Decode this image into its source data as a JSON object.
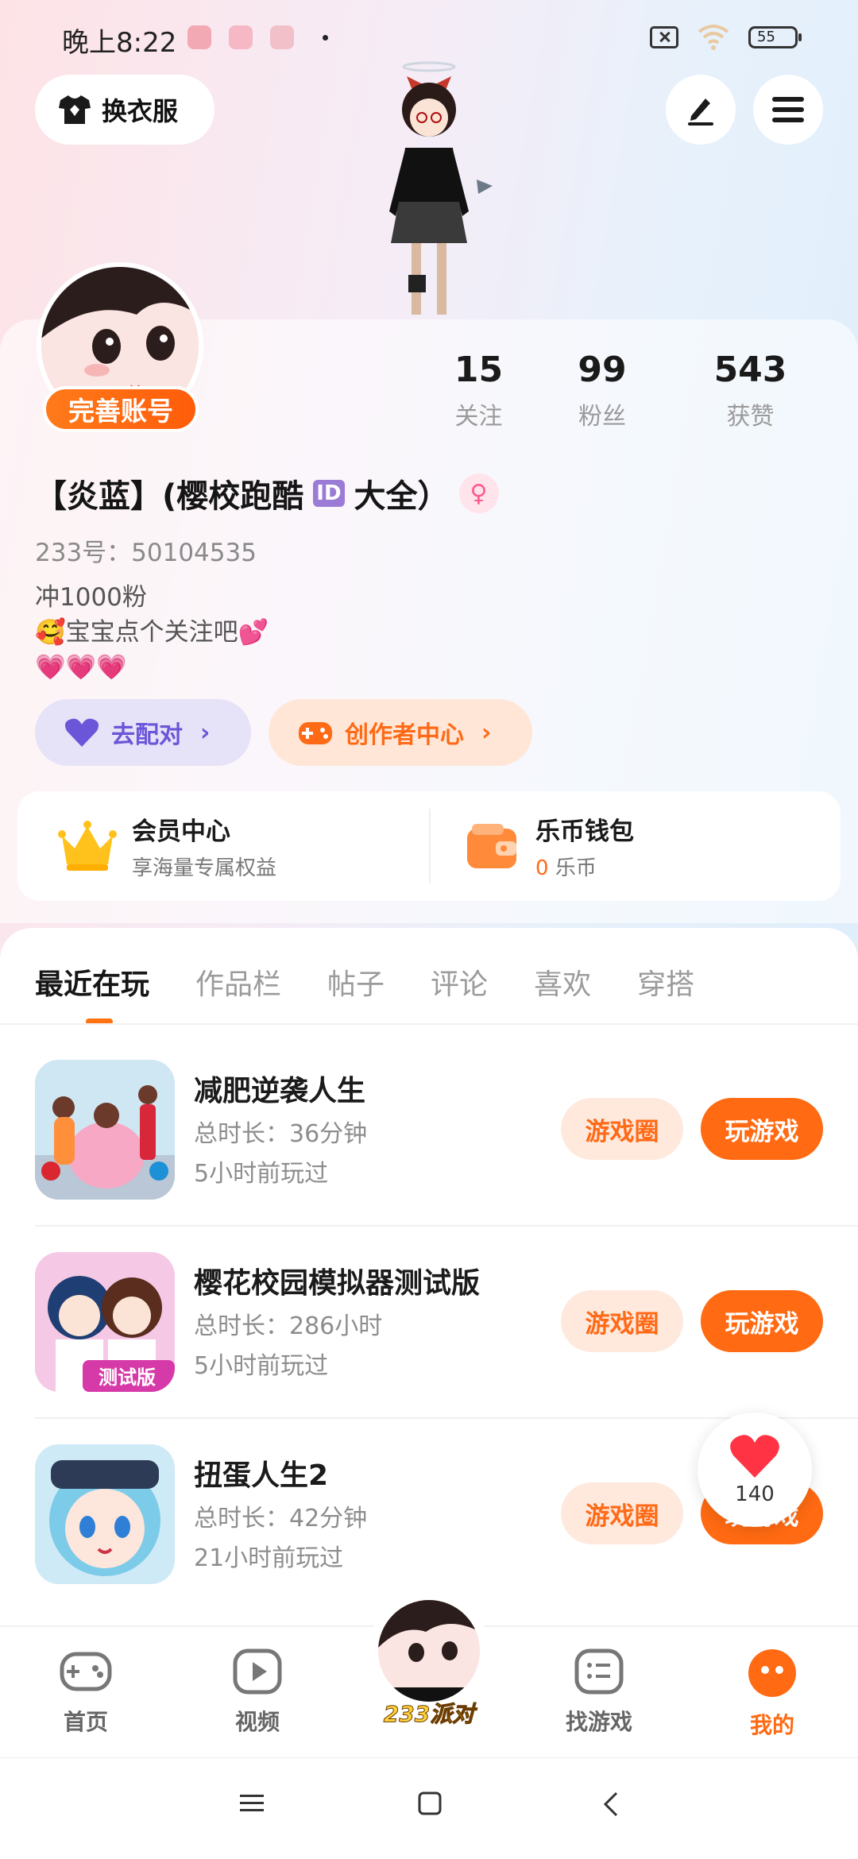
{
  "status_bar": {
    "time": "晚上8:22",
    "battery": "55"
  },
  "header": {
    "outfit_label": "换衣服",
    "edit_icon": "pen-icon",
    "menu_icon": "menu-icon"
  },
  "profile": {
    "complete_badge": "完善账号",
    "stats": [
      {
        "num": "15",
        "label": "关注"
      },
      {
        "num": "99",
        "label": "粉丝"
      },
      {
        "num": "543",
        "label": "获赞"
      }
    ],
    "nickname_part1": "【炎蓝】(樱校跑酷",
    "nickname_tag": "ID",
    "nickname_part2": "大全）",
    "uid": "233号：50104535",
    "bio": "冲1000粉\n🥰宝宝点个关注吧💕\n💗💗💗",
    "match_label": "去配对",
    "creator_label": "创作者中心"
  },
  "vip": {
    "title": "会员中心",
    "subtitle": "享海量专属权益",
    "wallet_title": "乐币钱包",
    "wallet_value": "0",
    "wallet_unit": "乐币"
  },
  "tabs": [
    "最近在玩",
    "作品栏",
    "帖子",
    "评论",
    "喜欢",
    "穿搭"
  ],
  "games": [
    {
      "name": "减肥逆袭人生",
      "duration": "总时长：36分钟",
      "last": "5小时前玩过",
      "circle": "游戏圈",
      "play": "玩游戏"
    },
    {
      "name": "樱花校园模拟器测试版",
      "duration": "总时长：286小时",
      "last": "5小时前玩过",
      "circle": "游戏圈",
      "play": "玩游戏"
    },
    {
      "name": "扭蛋人生2",
      "duration": "总时长：42分钟",
      "last": "21小时前玩过",
      "circle": "游戏圈",
      "play": "玩游戏"
    }
  ],
  "icon_badge": "测试版",
  "like_count": "140",
  "nav": {
    "home": "首页",
    "video": "视频",
    "center": "233派对",
    "find": "找游戏",
    "mine": "我的"
  },
  "colors": {
    "accent": "#ff6a12",
    "purple": "#6b56d9"
  }
}
